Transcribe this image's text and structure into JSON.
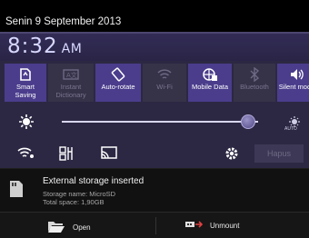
{
  "status": {
    "date": "Senin 9 September 2013"
  },
  "clock": {
    "time": "8:32",
    "ampm": "AM"
  },
  "toggles": [
    {
      "label": "Smart Saving",
      "line1": "Smart",
      "line2": "Saving",
      "icon": "smart-saving-icon",
      "state": "on"
    },
    {
      "label": "Instant Dictionary",
      "line1": "Instant",
      "line2": "Dictionary",
      "icon": "dictionary-icon",
      "state": "off"
    },
    {
      "label": "Auto-rotate",
      "line1": "Auto-rotate",
      "line2": "",
      "icon": "rotate-icon",
      "state": "on"
    },
    {
      "label": "Wi-Fi",
      "line1": "Wi-Fi",
      "line2": "",
      "icon": "wifi-icon",
      "state": "off"
    },
    {
      "label": "Mobile Data",
      "line1": "Mobile Data",
      "line2": "",
      "icon": "mobile-data-icon",
      "state": "on"
    },
    {
      "label": "Bluetooth",
      "line1": "Bluetooth",
      "line2": "",
      "icon": "bluetooth-icon",
      "state": "off"
    },
    {
      "label": "Silent mode",
      "line1": "Silent mode",
      "line2": "",
      "icon": "silent-mode-icon",
      "state": "on"
    }
  ],
  "brightness": {
    "level": 0.95,
    "auto_label": "AUTO"
  },
  "bottom_row": {
    "clear_label": "Hapus"
  },
  "notification": {
    "title": "External storage inserted",
    "storage_name": "Storage name: MicroSD",
    "total_space": "Total space: 1,90GB"
  },
  "actions": {
    "open_label": "Open",
    "unmount_label": "Unmount"
  },
  "colors": {
    "panel_bg": "#2c2843",
    "toggle_on": "#4b3d8c",
    "toggle_off": "#363248",
    "clock": "#d8d8ff"
  }
}
